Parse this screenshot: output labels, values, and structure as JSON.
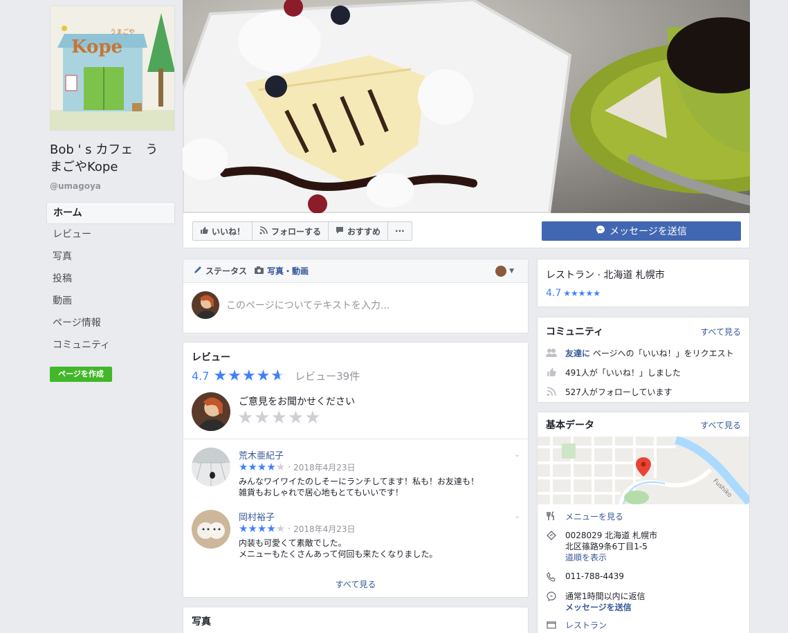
{
  "page": {
    "name_line1": "Bob ' s カフェ　う",
    "name_line2": "まごやKope",
    "handle": "@umagoya",
    "logo_text": "Kope",
    "logo_small": "うまごや"
  },
  "nav": {
    "items": [
      "ホーム",
      "レビュー",
      "写真",
      "投稿",
      "動画",
      "ページ情報",
      "コミュニティ"
    ],
    "create_page": "ページを作成"
  },
  "actions": {
    "like": "いいね！",
    "follow": "フォローする",
    "recommend": "おすすめ",
    "more": "···",
    "message": "メッセージを送信"
  },
  "composer": {
    "tab_status": "ステータス",
    "tab_photo": "写真・動画",
    "placeholder": "このページについてテキストを入力..."
  },
  "reviews": {
    "title": "レビュー",
    "rating": "4.7",
    "count": "レビュー39件",
    "prompt": "ご意見をお聞かせください",
    "see_all": "すべて見る",
    "items": [
      {
        "name": "荒木亜紀子",
        "date": "2018年4月23日",
        "stars": 4,
        "line1": "みんなワイワイたのしそーにランチしてます！私も！お友達も！",
        "line2": "雑貨もおしゃれで居心地もとてもいいです！"
      },
      {
        "name": "岡村裕子",
        "date": "2018年4月23日",
        "stars": 4,
        "line1": "内装も可愛くて素敵でした。",
        "line2": "メニューもたくさんあって何回も来たくなりました。"
      }
    ]
  },
  "photos": {
    "title": "写真"
  },
  "category": {
    "text": "レストラン · 北海道 札幌市",
    "rating": "4.7"
  },
  "community": {
    "title": "コミュニティ",
    "see_all": "すべて見る",
    "invite_link": "友達に",
    "invite_text": "ページへの「いいね！」をリクエスト",
    "likes": "491人が「いいね！」しました",
    "follows": "527人がフォローしています"
  },
  "about": {
    "title": "基本データ",
    "see_all": "すべて見る",
    "menu": "メニューを見る",
    "address1": "0028029 北海道 札幌市",
    "address2": "北区篠路9条6丁目1-5",
    "directions": "道順を表示",
    "phone": "011-788-4439",
    "response": "通常1時間以内に返信",
    "send_message": "メッセージを送信",
    "type": "レストラン",
    "map_label": "Fushiko"
  }
}
